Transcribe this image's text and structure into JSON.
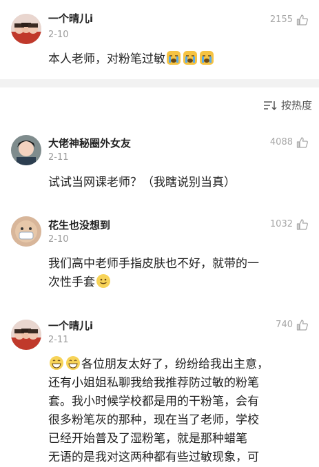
{
  "comments": [
    {
      "name": "一个晴儿i",
      "date": "2-10",
      "likes": "2155",
      "text": "本人老师，对粉笔过敏"
    },
    {
      "name": "大佬神秘圈外女友",
      "date": "2-11",
      "likes": "4088",
      "text": "试试当网课老师？（我瞎说别当真）"
    },
    {
      "name": "花生也没想到",
      "date": "2-10",
      "likes": "1032",
      "text_line1": "我们高中老师手指皮肤也不好，就带的一",
      "text_line2": "次性手套"
    },
    {
      "name": "一个晴儿i",
      "date": "2-11",
      "likes": "740",
      "text_line1": "各位朋友太好了，纷纷给我出主意，",
      "text_line2": "还有小姐姐私聊我给我推荐防过敏的粉笔",
      "text_line3": "套。我小时候学校都是用的干粉笔，会有",
      "text_line4": "很多粉笔灰的那种，现在当了老师，学校",
      "text_line5": "已经开始普及了湿粉笔，就是那种蜡笔",
      "text_line6": "无语的是我对这两种都有些过敏现象，可"
    }
  ],
  "sort": {
    "label": "按热度",
    "icon": "sort-icon"
  },
  "icons": {
    "like": "thumbs-up-icon"
  },
  "colors": {
    "separator": "#f2f2f2",
    "muted": "#9a9a9a"
  }
}
